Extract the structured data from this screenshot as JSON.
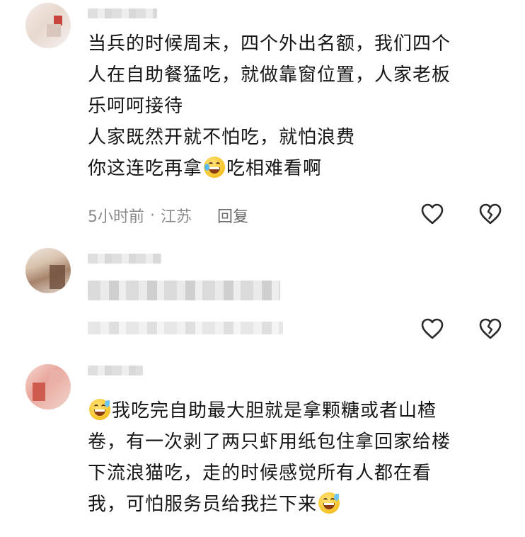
{
  "comments": [
    {
      "lines": [
        "当兵的时候周末，四个外出名额，我们四个",
        "人在自助餐猛吃，就做靠窗位置，人家老板",
        "乐呵呵接待",
        "人家既然开就不怕吃，就怕浪费"
      ],
      "last_line_before": "你这连吃再拿",
      "last_line_after": "吃相难看啊",
      "emoji": "laughing-crying-emoji",
      "meta": {
        "time": "5小时前",
        "separator": "·",
        "location": "江苏",
        "reply": "回复"
      }
    },
    {
      "blurred": true
    },
    {
      "first_line_after_emoji": "我吃完自助最大胆就是拿颗糖或者山楂",
      "lines": [
        "卷，有一次剥了两只虾用纸包住拿回家给楼",
        "下流浪猫吃，走的时候感觉所有人都在看"
      ],
      "last_line": "我，可怕服务员给我拦下来",
      "emoji": "grinning-sweat-emoji"
    }
  ],
  "icons": {
    "like": "heart-outline-icon",
    "dislike": "broken-heart-outline-icon"
  },
  "colors": {
    "text": "#161616",
    "meta": "#8a8a8a",
    "icon": "#2a2a2a"
  }
}
